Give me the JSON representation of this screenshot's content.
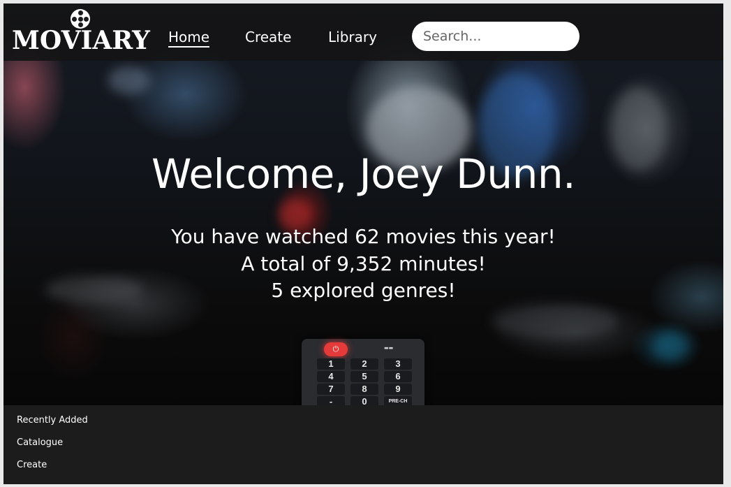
{
  "brand": {
    "name": "MOVIARY"
  },
  "nav": {
    "links": [
      {
        "label": "Home",
        "active": true
      },
      {
        "label": "Create",
        "active": false
      },
      {
        "label": "Library",
        "active": false
      }
    ],
    "search": {
      "placeholder": "Search...",
      "value": ""
    }
  },
  "hero": {
    "welcome": "Welcome, Joey Dunn.",
    "stats": [
      "You have watched 62 movies this year!",
      "A total of 9,352 minutes!",
      "5 explored genres!"
    ]
  },
  "remote": {
    "power_icon": "power-icon",
    "keys": [
      "1",
      "2",
      "3",
      "4",
      "5",
      "6",
      "7",
      "8",
      "9",
      "-",
      "0",
      "PRE-CH"
    ]
  },
  "footer": {
    "links": [
      "Recently Added",
      "Catalogue",
      "Create"
    ]
  },
  "colors": {
    "navbar": "#141416",
    "page_background": "#1c1c1c",
    "power_button": "#e53a3a"
  }
}
